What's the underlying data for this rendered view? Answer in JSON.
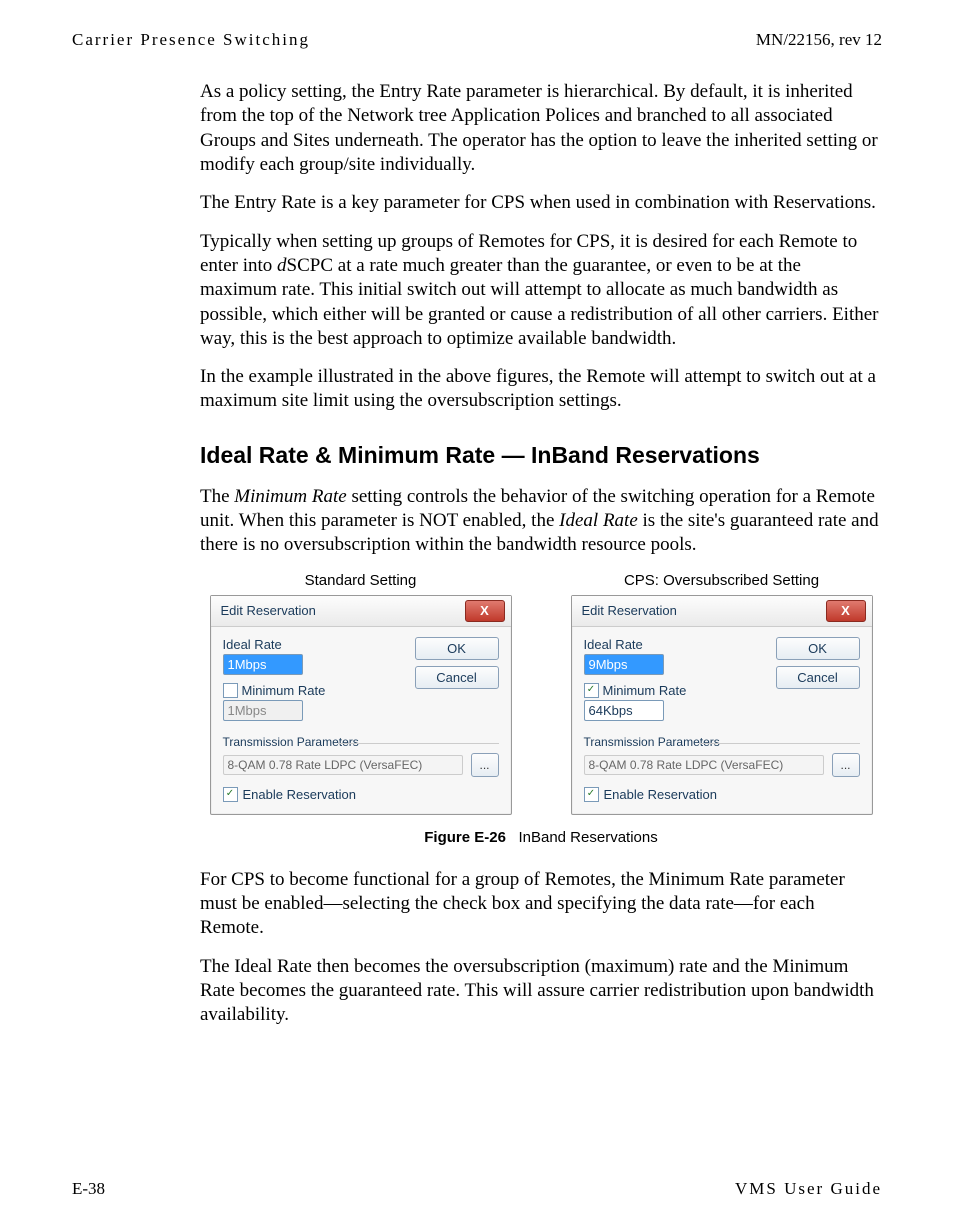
{
  "header": {
    "left": "Carrier Presence Switching",
    "right": "MN/22156, rev 12"
  },
  "paragraphs": {
    "p1": "As a policy setting, the Entry Rate parameter is hierarchical. By default, it is inherited from the top of the Network tree Application Polices and branched to all associated Groups and Sites underneath. The operator has the option to leave the inherited setting or modify each group/site individually.",
    "p2": "The Entry Rate is a key parameter for CPS when used in combination with Reservations.",
    "p3a": "Typically when setting up groups of Remotes for CPS, it is desired for each Remote to enter into ",
    "p3i": "d",
    "p3b": "SCPC at a rate much greater than the guarantee, or even to be at the maximum rate. This initial switch out will attempt to allocate as much bandwidth as possible, which either will be granted or cause a redistribution of all other carriers. Either way, this is the best approach to optimize available bandwidth.",
    "p4": "In the example illustrated in the above figures, the Remote will attempt to switch out at a maximum site limit using the oversubscription settings.",
    "h2": "Ideal Rate & Minimum Rate — InBand Reservations",
    "p5a": "The ",
    "p5i1": "Minimum Rate",
    "p5b": " setting controls the behavior of the switching operation for a Remote unit. When this parameter is NOT enabled, the ",
    "p5i2": "Ideal Rate",
    "p5c": " is the site's guaranteed rate and there is no oversubscription within the bandwidth resource pools.",
    "p6": "For CPS to become functional for a group of Remotes, the Minimum Rate parameter must be enabled—selecting the check box and specifying the data rate—for each Remote.",
    "p7": "The Ideal Rate then becomes the oversubscription (maximum) rate and the Minimum Rate becomes the guaranteed rate. This will assure carrier redistribution upon bandwidth availability."
  },
  "figure": {
    "left_label": "Standard Setting",
    "right_label": "CPS: Oversubscribed Setting",
    "caption_bold": "Figure E-26",
    "caption_rest": "InBand Reservations"
  },
  "dialog": {
    "title": "Edit Reservation",
    "close_glyph": "X",
    "ideal_label": "Ideal Rate",
    "minrate_label": "Minimum Rate",
    "ok_label": "OK",
    "cancel_label": "Cancel",
    "tx_group": "Transmission Parameters",
    "tx_value": "8-QAM 0.78 Rate  LDPC (VersaFEC)",
    "ellipsis": "...",
    "enable_label": "Enable Reservation",
    "check_glyph": "✓",
    "left": {
      "ideal_value": "1Mbps",
      "min_checked": false,
      "min_value": "1Mbps",
      "enable_checked": true
    },
    "right": {
      "ideal_value": "9Mbps",
      "min_checked": true,
      "min_value": "64Kbps",
      "enable_checked": true
    }
  },
  "footer": {
    "left": "E-38",
    "right": "VMS User Guide"
  }
}
